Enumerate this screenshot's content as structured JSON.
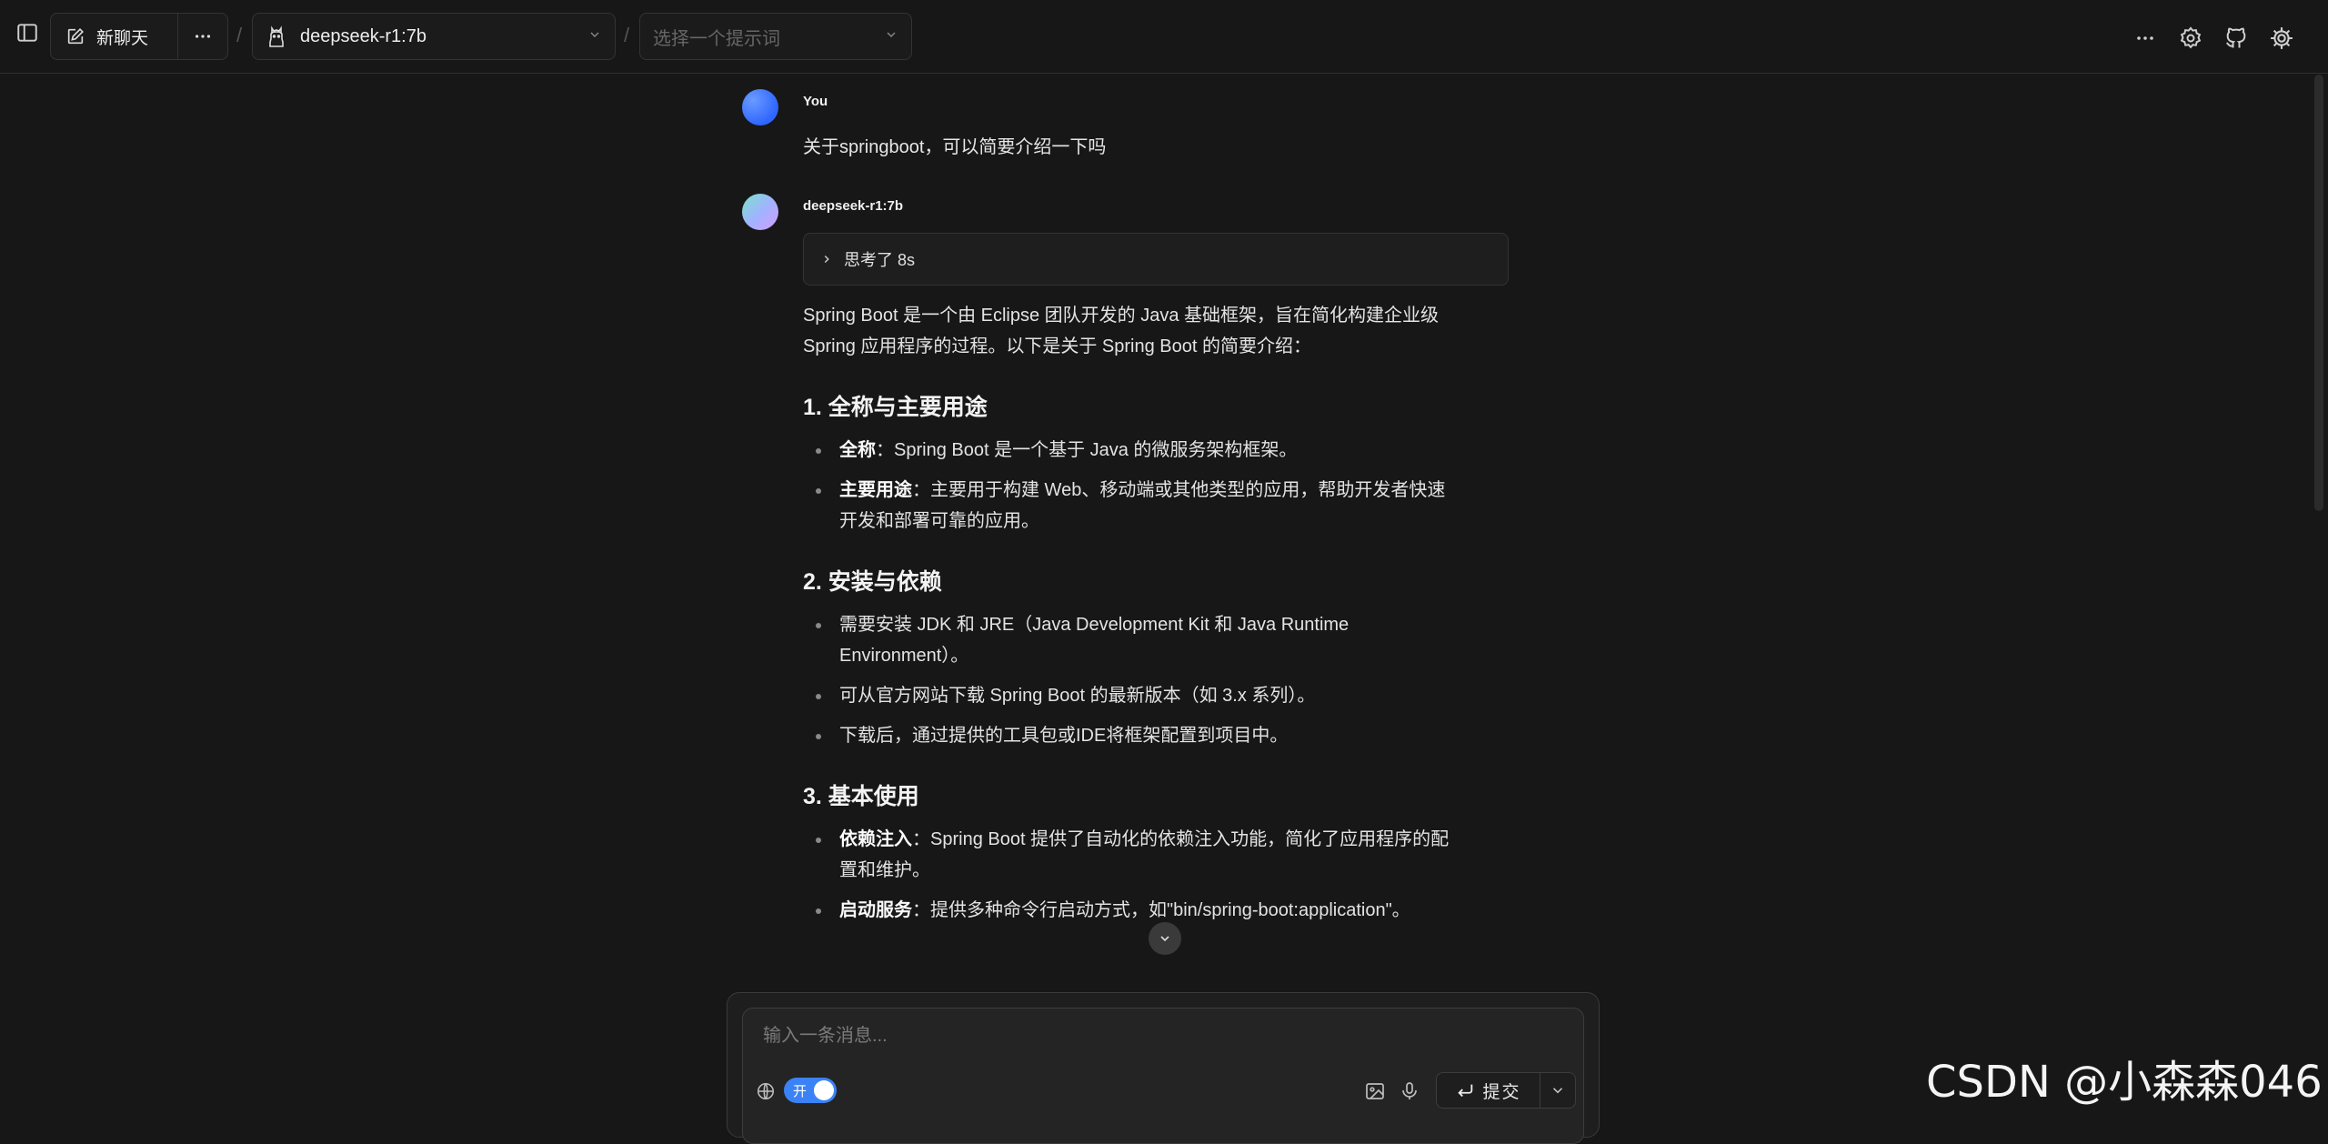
{
  "toolbar": {
    "new_chat_label": "新聊天",
    "model_name": "deepseek-r1:7b",
    "prompt_placeholder": "选择一个提示词",
    "breadcrumb_separator": "/"
  },
  "messages": {
    "user": {
      "sender": "You",
      "text": "关于springboot，可以简要介绍一下吗"
    },
    "assistant": {
      "sender": "deepseek-r1:7b",
      "thinking_label": "思考了 8s",
      "intro_line1": "Spring Boot 是一个由 Eclipse 团队开发的 Java 基础框架，旨在简化构建企业级",
      "intro_line2": "Spring 应用程序的过程。以下是关于 Spring Boot 的简要介绍：",
      "sections": [
        {
          "heading": "1. 全称与主要用途",
          "items": [
            {
              "bold": "全称",
              "text": "：Spring Boot 是一个基于 Java 的微服务架构框架。"
            },
            {
              "bold": "主要用途",
              "text": "：主要用于构建 Web、移动端或其他类型的应用，帮助开发者快速",
              "text2": "开发和部署可靠的应用。"
            }
          ]
        },
        {
          "heading": "2. 安装与依赖",
          "items": [
            {
              "text": "需要安装 JDK 和 JRE（Java Development Kit 和 Java Runtime",
              "text2": "Environment）。"
            },
            {
              "text": "可从官方网站下载 Spring Boot 的最新版本（如 3.x 系列）。"
            },
            {
              "text": "下载后，通过提供的工具包或IDE将框架配置到项目中。"
            }
          ]
        },
        {
          "heading": "3. 基本使用",
          "items": [
            {
              "bold": "依赖注入",
              "text": "：Spring Boot 提供了自动化的依赖注入功能，简化了应用程序的配",
              "text2": "置和维护。"
            },
            {
              "bold": "启动服务",
              "text": "：提供多种命令行启动方式，如\"bin/spring-boot:application\"。"
            }
          ]
        }
      ]
    }
  },
  "composer": {
    "placeholder": "输入一条消息...",
    "web_toggle_label": "开",
    "submit_label": "提交"
  },
  "watermark": "CSDN @小森森046",
  "colors": {
    "background": "#171717",
    "accent": "#3b82f6"
  }
}
